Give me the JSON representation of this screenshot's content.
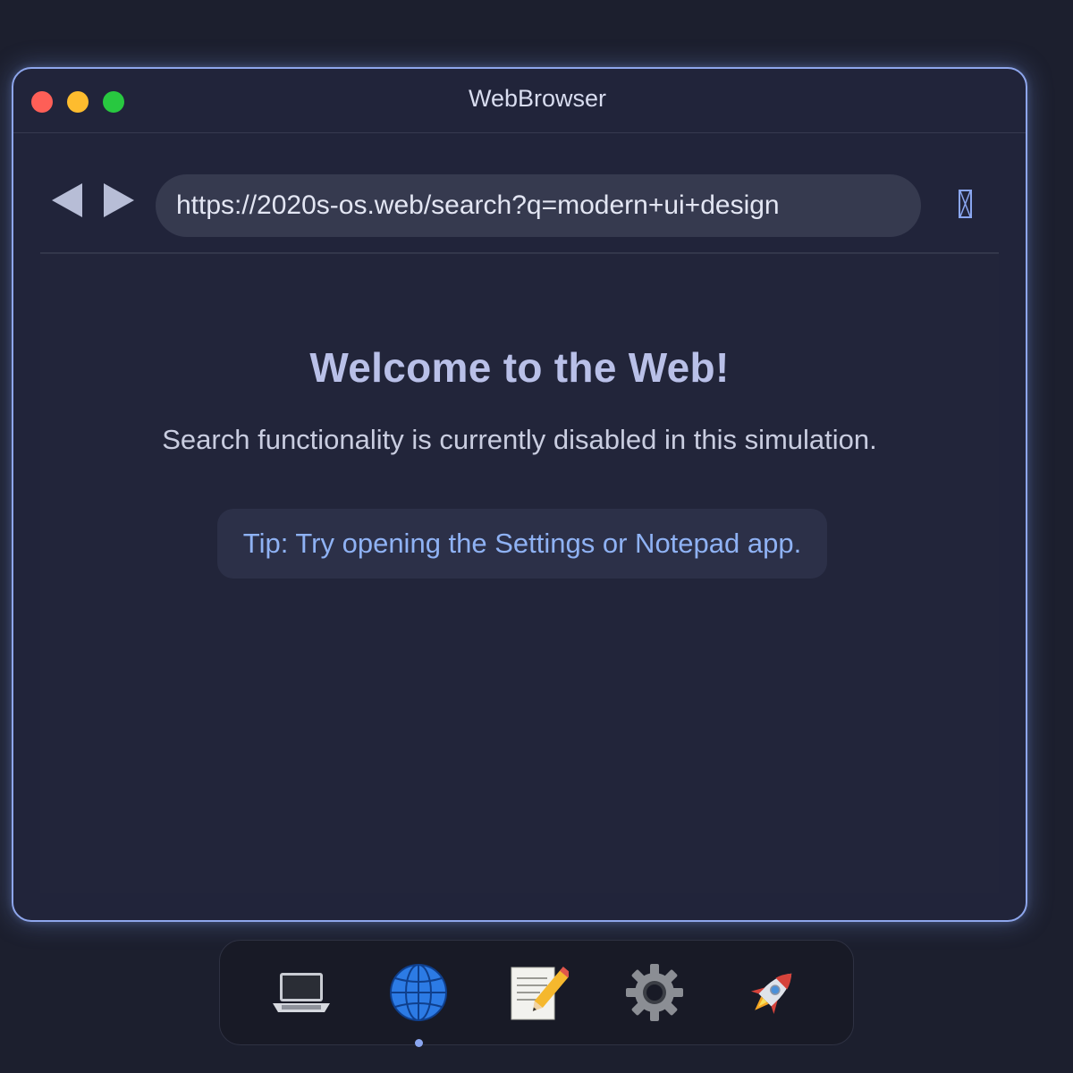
{
  "window": {
    "title": "WebBrowser"
  },
  "toolbar": {
    "back_icon": "back-arrow-icon",
    "forward_icon": "forward-arrow-icon",
    "url": "https://2020s-os.web/search?q=modern+ui+design",
    "refresh_icon": "refresh-icon"
  },
  "page": {
    "heading": "Welcome to the Web!",
    "subtitle": "Search functionality is currently disabled in this simulation.",
    "tip": "Tip: Try opening the Settings or Notepad app."
  },
  "dock": {
    "items": [
      {
        "icon": "laptop-icon",
        "app": "terminal"
      },
      {
        "icon": "globe-icon",
        "app": "webbrowser",
        "active": true
      },
      {
        "icon": "notepad-icon",
        "app": "notepad"
      },
      {
        "icon": "gear-icon",
        "app": "settings"
      },
      {
        "icon": "rocket-icon",
        "app": "launcher"
      }
    ]
  },
  "colors": {
    "accent": "#8aa6f0",
    "close": "#fe5f57",
    "minimize": "#febc2e",
    "maximize": "#28c840",
    "window_bg": "#21243a",
    "desktop_bg": "#1c1f2e"
  }
}
